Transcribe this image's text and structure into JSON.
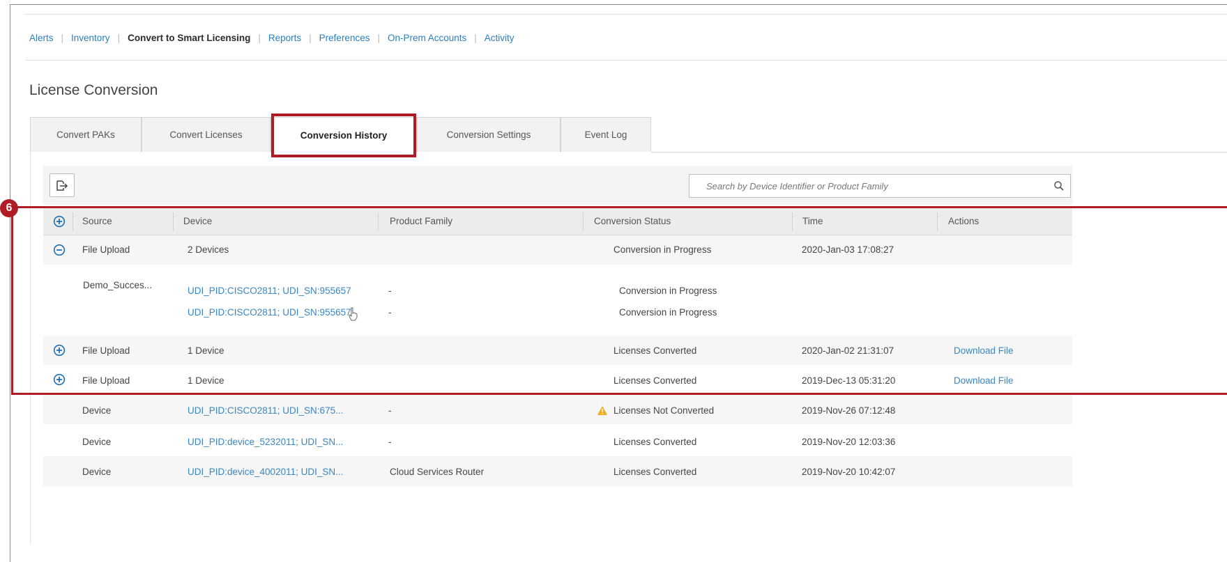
{
  "nav": {
    "items": [
      {
        "label": "Alerts",
        "active": false
      },
      {
        "label": "Inventory",
        "active": false
      },
      {
        "label": "Convert to Smart Licensing",
        "active": true
      },
      {
        "label": "Reports",
        "active": false
      },
      {
        "label": "Preferences",
        "active": false
      },
      {
        "label": "On-Prem Accounts",
        "active": false
      },
      {
        "label": "Activity",
        "active": false
      }
    ],
    "separator": "|"
  },
  "page_title": "License Conversion",
  "tabs": [
    {
      "label": "Convert PAKs"
    },
    {
      "label": "Convert Licenses"
    },
    {
      "label": "Conversion History",
      "active": true
    },
    {
      "label": "Conversion Settings"
    },
    {
      "label": "Event Log"
    }
  ],
  "toolbar": {
    "export_icon": "export-icon",
    "search_placeholder": "Search by Device Identifier or Product Family",
    "search_icon": "search-icon"
  },
  "table": {
    "columns": [
      "Source",
      "Device",
      "Product Family",
      "Conversion Status",
      "Time",
      "Actions"
    ],
    "rows": [
      {
        "toggle": "collapse",
        "source": "File Upload",
        "device": "2 Devices",
        "product_family": "",
        "status": "Conversion in Progress",
        "time": "2020-Jan-03 17:08:27",
        "action": ""
      },
      {
        "source": "Demo_Succes...",
        "devices": [
          {
            "device": "UDI_PID:CISCO2811; UDI_SN:955657",
            "product_family": "-",
            "status": "Conversion in Progress"
          },
          {
            "device": "UDI_PID:CISCO2811; UDI_SN:955657",
            "product_family": "-",
            "status": "Conversion in Progress"
          }
        ]
      },
      {
        "toggle": "expand",
        "source": "File Upload",
        "device": "1 Device",
        "product_family": "",
        "status": "Licenses Converted",
        "time": "2020-Jan-02 21:31:07",
        "action": "Download File"
      },
      {
        "toggle": "expand",
        "source": "File Upload",
        "device": "1 Device",
        "product_family": "",
        "status": "Licenses Converted",
        "time": "2019-Dec-13 05:31:20",
        "action": "Download File"
      },
      {
        "source": "Device",
        "device": "UDI_PID:CISCO2811; UDI_SN:675...",
        "product_family": "-",
        "status": "Licenses Not Converted",
        "warning": true,
        "time": "2019-Nov-26 07:12:48",
        "action": ""
      },
      {
        "source": "Device",
        "device": "UDI_PID:device_5232011; UDI_SN...",
        "product_family": "-",
        "status": "Licenses Converted",
        "time": "2019-Nov-20 12:03:36",
        "action": ""
      },
      {
        "source": "Device",
        "device": "UDI_PID:device_4002011; UDI_SN...",
        "product_family": "Cloud Services Router",
        "status": "Licenses Converted",
        "time": "2019-Nov-20 10:42:07",
        "action": ""
      }
    ]
  },
  "annotation": {
    "badge": "6"
  },
  "colors": {
    "accent_red": "#b01c26",
    "link": "#3a86c2",
    "toggle": "#1f6fb5",
    "warning": "#f0ad1a"
  }
}
